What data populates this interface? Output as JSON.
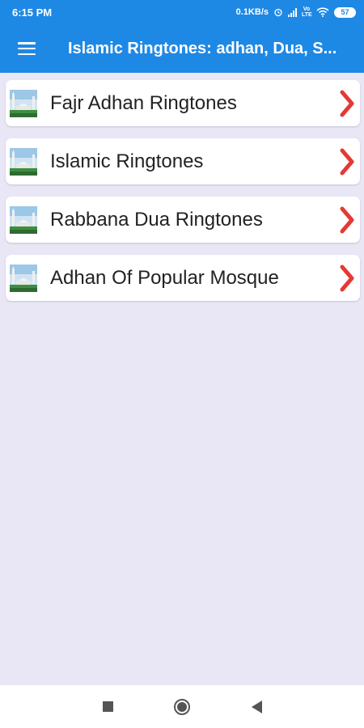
{
  "status_bar": {
    "time": "6:15 PM",
    "network_speed": "0.1KB/s",
    "network_type": "Vo LTE",
    "battery": "57"
  },
  "app_bar": {
    "title": "Islamic Ringtones: adhan, Dua, S...",
    "menu_icon": "hamburger-menu-icon"
  },
  "items": [
    {
      "label": "Fajr Adhan Ringtones"
    },
    {
      "label": "Islamic Ringtones"
    },
    {
      "label": "Rabbana Dua Ringtones"
    },
    {
      "label": "Adhan Of Popular Mosque"
    }
  ],
  "nav_bar": {
    "recents_icon": "square-icon",
    "home_icon": "circle-icon",
    "back_icon": "triangle-back-icon"
  },
  "colors": {
    "primary": "#1e88e5",
    "background": "#e9e6f6",
    "chevron": "#e53935"
  }
}
